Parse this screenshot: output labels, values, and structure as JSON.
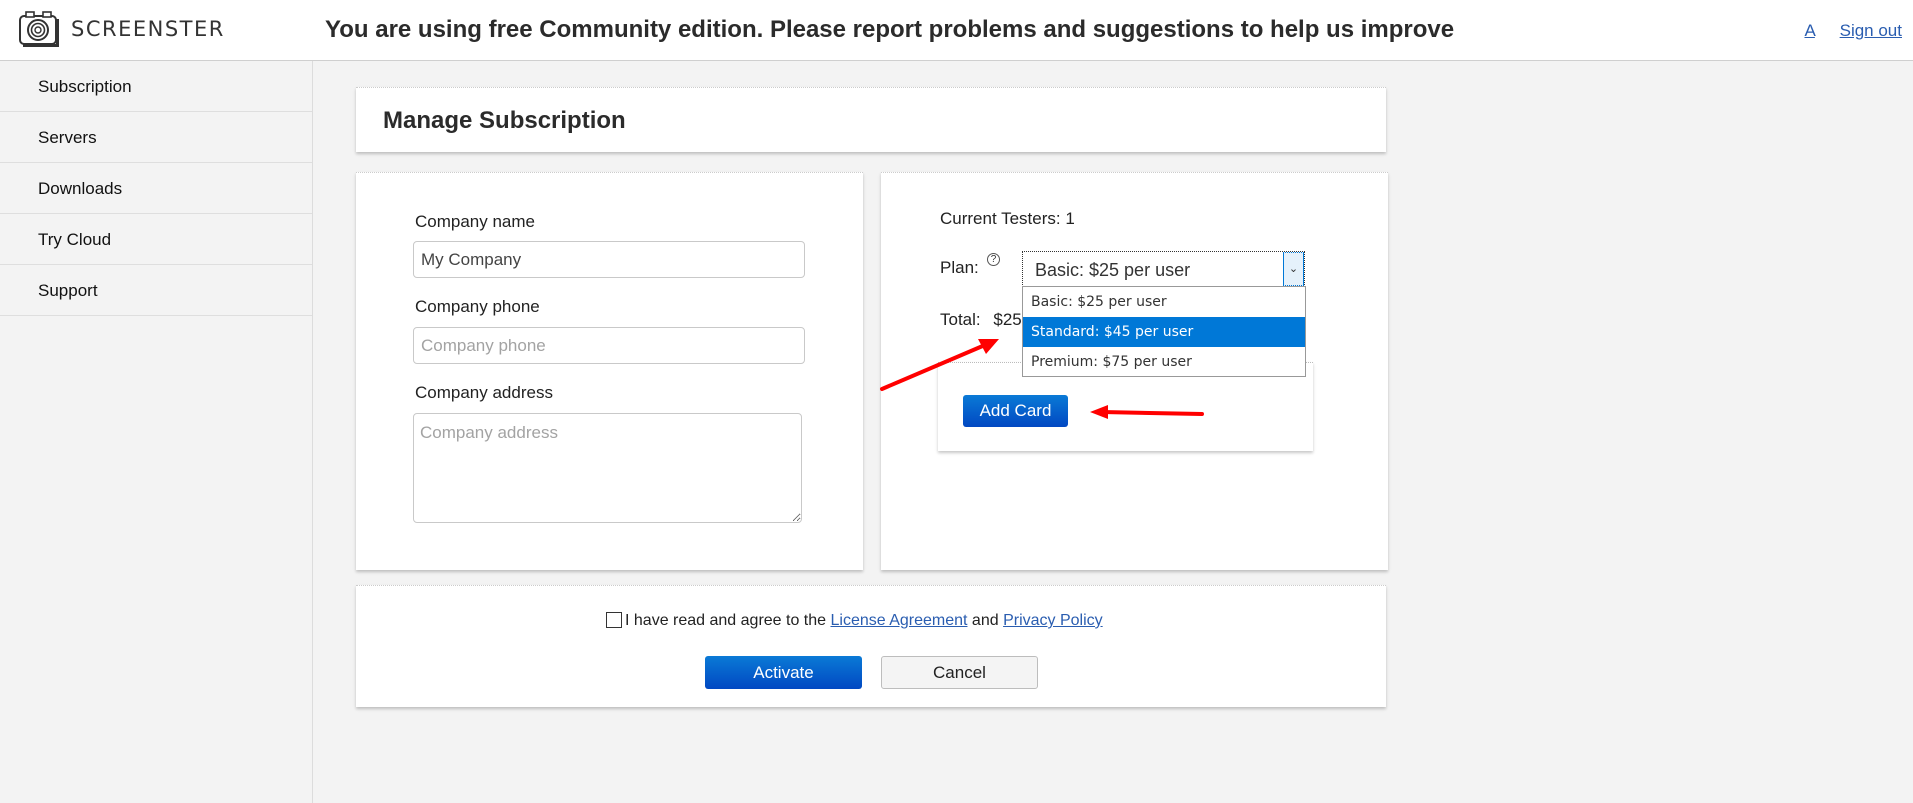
{
  "header": {
    "brand": "SCREENSTER",
    "banner": "You are using free Community edition. Please report problems and suggestions to help us improve",
    "user_link": "A",
    "sign_out": "Sign out"
  },
  "sidebar": {
    "items": [
      {
        "label": "Subscription"
      },
      {
        "label": "Servers"
      },
      {
        "label": "Downloads"
      },
      {
        "label": "Try Cloud"
      },
      {
        "label": "Support"
      }
    ]
  },
  "page": {
    "title": "Manage Subscription"
  },
  "company_form": {
    "name_label": "Company name",
    "name_value": "My Company",
    "phone_label": "Company phone",
    "phone_placeholder": "Company phone",
    "address_label": "Company address",
    "address_placeholder": "Company address"
  },
  "subscription": {
    "current_testers": "Current Testers: 1",
    "plan_label": "Plan:",
    "help_icon": "?",
    "plan_selected": "Basic: $25 per user",
    "plan_options": [
      {
        "label": "Basic: $25 per user",
        "highlighted": false
      },
      {
        "label": "Standard: $45 per user",
        "highlighted": true
      },
      {
        "label": "Premium: $75 per user",
        "highlighted": false
      }
    ],
    "total_label": "Total:",
    "total_value": "$25",
    "add_card": "Add Card"
  },
  "agreement": {
    "text_before": "I have read and agree to the ",
    "license_link": "License Agreement",
    "text_mid": " and ",
    "privacy_link": "Privacy Policy",
    "checked": false
  },
  "actions": {
    "activate": "Activate",
    "cancel": "Cancel"
  },
  "colors": {
    "accent_blue": "#0078d7",
    "link_blue": "#2a5db0",
    "annotation_red": "#ff0000"
  }
}
